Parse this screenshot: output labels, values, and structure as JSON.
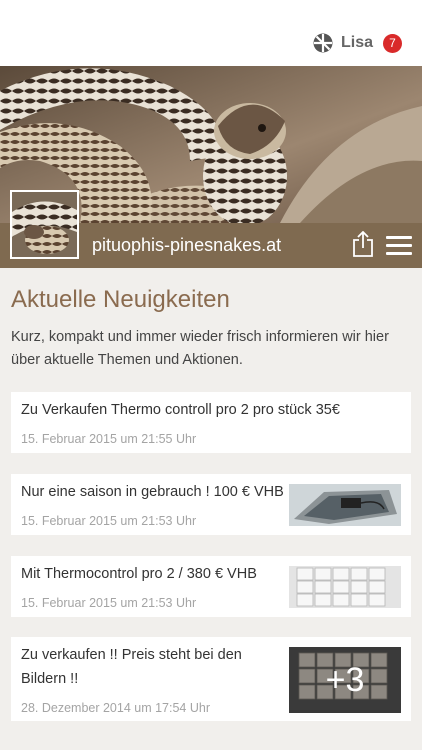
{
  "user": {
    "name": "Lisa",
    "badge_count": "7"
  },
  "site": {
    "name": "pituophis-pinesnakes.at"
  },
  "news": {
    "heading": "Aktuelle Neuigkeiten",
    "intro": "Kurz, kompakt und immer wieder frisch informieren wir hier über aktuelle Themen und Aktionen.",
    "items": [
      {
        "title": "Zu Verkaufen Thermo controll pro 2 pro stück 35€",
        "date": "15. Februar 2015 um 21:55 Uhr"
      },
      {
        "title": "Nur eine saison in gebrauch ! 100 € VHB",
        "date": "15. Februar 2015 um 21:53 Uhr"
      },
      {
        "title": "Mit Thermocontrol pro 2 / 380 € VHB",
        "date": "15. Februar 2015 um 21:53 Uhr"
      },
      {
        "title": "Zu verkaufen !! Preis steht bei den Bildern !!",
        "date": "28. Dezember 2014 um 17:54 Uhr",
        "more_images": "+3"
      }
    ]
  },
  "colors": {
    "brand_bar": "#7f6a50",
    "title": "#8a6b4f",
    "badge": "#d92a2a"
  }
}
